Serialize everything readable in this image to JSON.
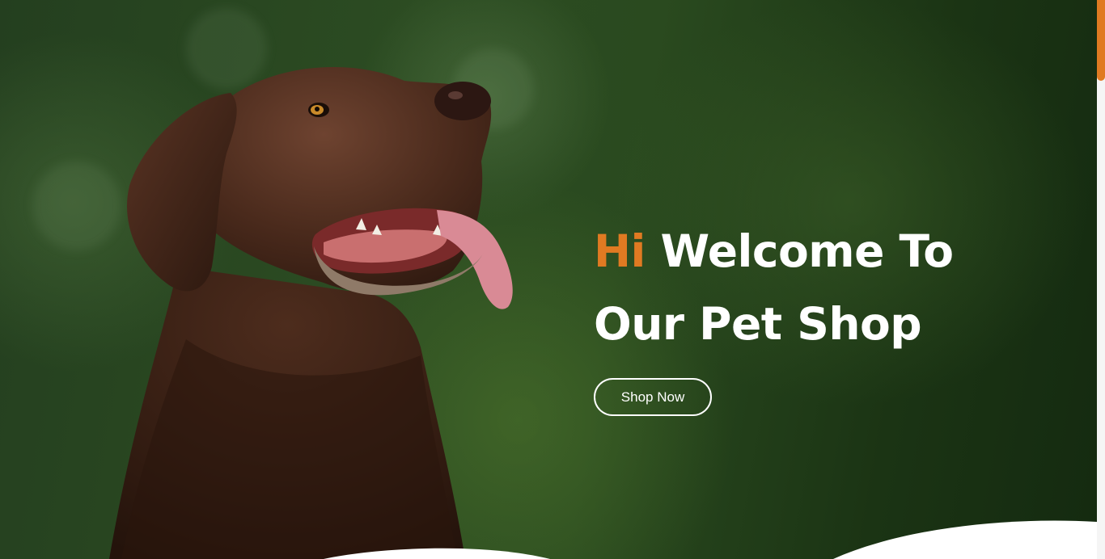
{
  "hero": {
    "greeting": "Hi",
    "title_line1_rest": " Welcome To",
    "title_line2": "Our Pet Shop",
    "button_label": "Shop Now"
  },
  "colors": {
    "accent": "#e07a22",
    "text": "#ffffff",
    "background": "#2c4c22"
  },
  "images": {
    "hero_image": "chocolate-labrador-dog"
  },
  "icons": {
    "scrollbar": "scrollbar-thumb"
  }
}
